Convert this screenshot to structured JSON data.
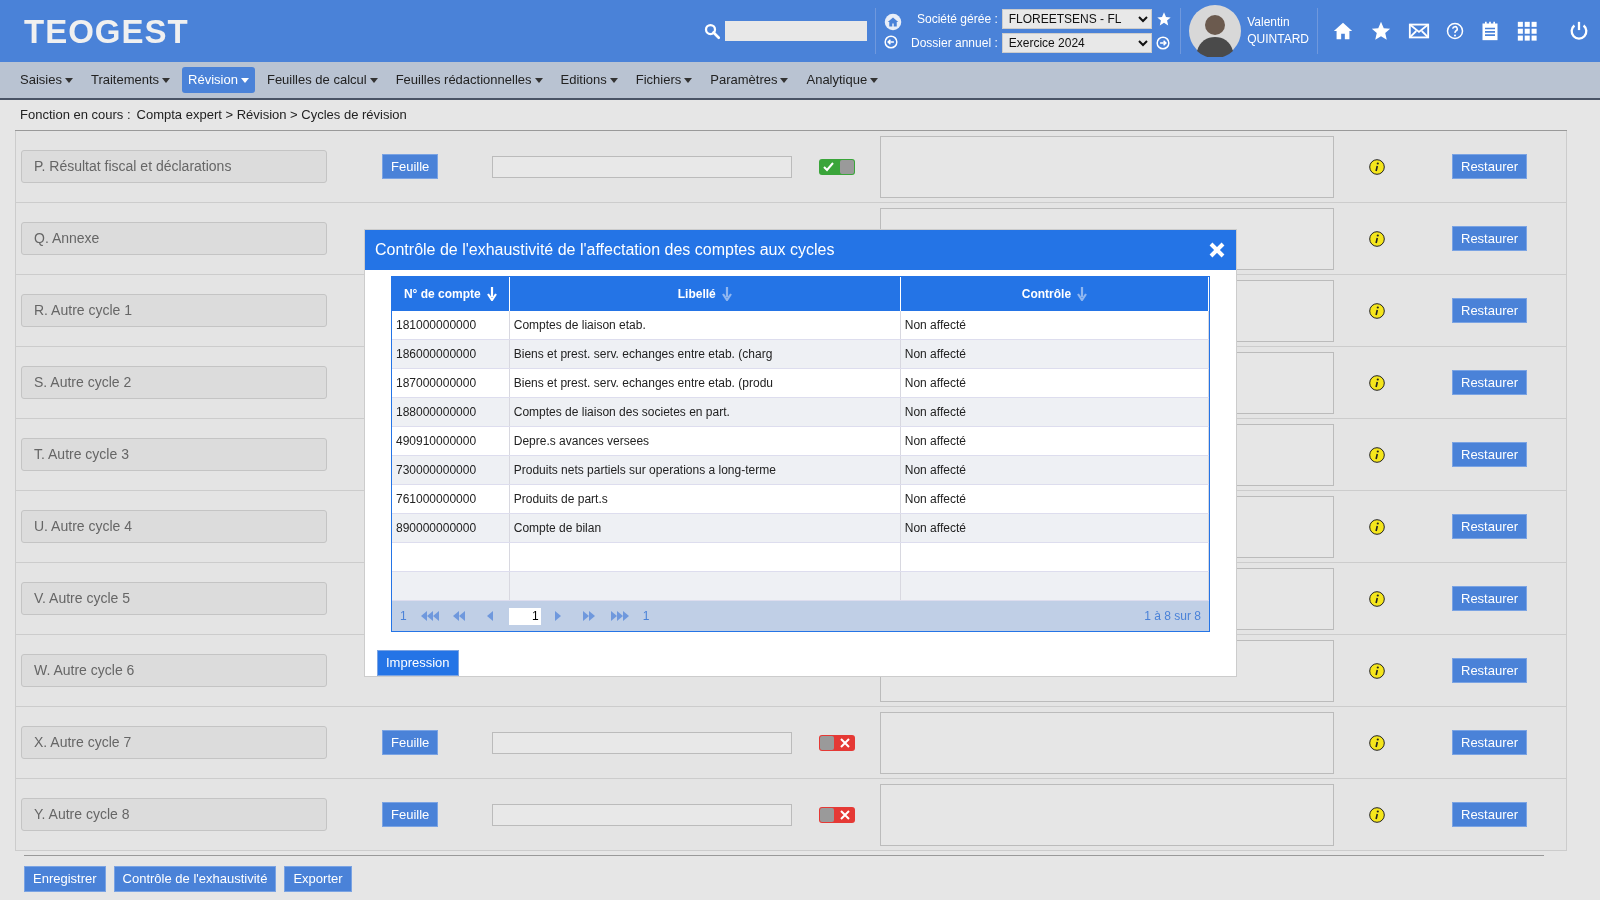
{
  "header": {
    "logo": "TEOGEST",
    "company": {
      "label": "Société gérée :",
      "value": "FLOREETSENS - FL"
    },
    "year": {
      "label": "Dossier annuel :",
      "value": "Exercice 2024"
    },
    "user": {
      "first_name": "Valentin",
      "last_name": "QUINTARD"
    }
  },
  "menu": [
    {
      "label": "Saisies",
      "selected": false
    },
    {
      "label": "Traitements",
      "selected": false
    },
    {
      "label": "Révision",
      "selected": true
    },
    {
      "label": "Feuilles de calcul",
      "selected": false
    },
    {
      "label": "Feuilles rédactionnelles",
      "selected": false
    },
    {
      "label": "Editions",
      "selected": false
    },
    {
      "label": "Fichiers",
      "selected": false
    },
    {
      "label": "Paramètres",
      "selected": false
    },
    {
      "label": "Analytique",
      "selected": false
    }
  ],
  "breadcrumb": {
    "label": "Fonction en cours :",
    "path": "Compta expert > Révision > Cycles de révision"
  },
  "cycles": [
    {
      "name": "P. Résultat fiscal et déclarations",
      "sheet_button": "Feuille",
      "on": true,
      "restore_button": "Restaurer"
    },
    {
      "name": "Q. Annexe",
      "restore_button": "Restaurer"
    },
    {
      "name": "R. Autre cycle 1",
      "restore_button": "Restaurer"
    },
    {
      "name": "S. Autre cycle 2",
      "restore_button": "Restaurer"
    },
    {
      "name": "T. Autre cycle 3",
      "restore_button": "Restaurer"
    },
    {
      "name": "U. Autre cycle 4",
      "restore_button": "Restaurer"
    },
    {
      "name": "V. Autre cycle 5",
      "restore_button": "Restaurer"
    },
    {
      "name": "W. Autre cycle 6",
      "restore_button": "Restaurer"
    },
    {
      "name": "X. Autre cycle 7",
      "sheet_button": "Feuille",
      "on": false,
      "restore_button": "Restaurer"
    },
    {
      "name": "Y. Autre cycle 8",
      "sheet_button": "Feuille",
      "on": false,
      "restore_button": "Restaurer"
    }
  ],
  "footer_buttons": [
    "Enregistrer",
    "Contrôle de l'exhaustivité",
    "Exporter"
  ],
  "modal": {
    "title": "Contrôle de l'exhaustivité de l'affectation des comptes aux cycles",
    "columns": [
      {
        "label": "N° de compte",
        "sorted": true
      },
      {
        "label": "Libellé",
        "sorted": false
      },
      {
        "label": "Contrôle",
        "sorted": false
      }
    ],
    "rows": [
      {
        "account": "181000000000",
        "label": "Comptes de liaison etab.",
        "status": "Non affecté"
      },
      {
        "account": "186000000000",
        "label": "Biens et prest. serv. echanges entre etab. (charg",
        "status": "Non affecté"
      },
      {
        "account": "187000000000",
        "label": "Biens et prest. serv. echanges entre etab. (produ",
        "status": "Non affecté"
      },
      {
        "account": "188000000000",
        "label": "Comptes de liaison des societes en part.",
        "status": "Non affecté"
      },
      {
        "account": "490910000000",
        "label": "Depre.s avances versees",
        "status": "Non affecté"
      },
      {
        "account": "730000000000",
        "label": "Produits nets partiels sur operations a long-terme",
        "status": "Non affecté"
      },
      {
        "account": "761000000000",
        "label": "Produits de part.s",
        "status": "Non affecté"
      },
      {
        "account": "890000000000",
        "label": "Compte de bilan",
        "status": "Non affecté"
      }
    ],
    "pager": {
      "first_page": "1",
      "page": "1",
      "last_page": "1",
      "summary": "1 à 8 sur 8"
    },
    "print_button": "Impression"
  }
}
